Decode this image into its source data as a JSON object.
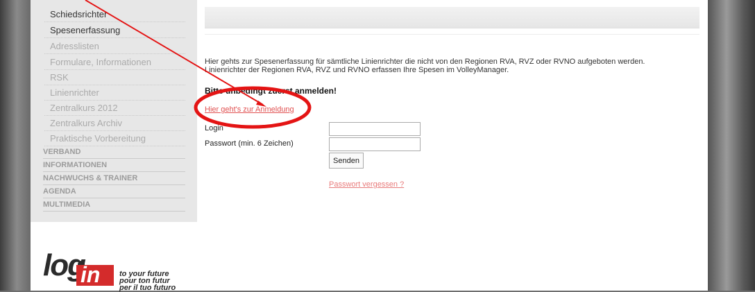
{
  "sidebar": {
    "sub_items": [
      {
        "label": "Schiedsrichter"
      },
      {
        "label": "Spesenerfassung"
      },
      {
        "label": "Adresslisten"
      },
      {
        "label": "Formulare, Informationen"
      },
      {
        "label": "RSK"
      },
      {
        "label": "Linienrichter"
      },
      {
        "label": "Zentralkurs 2012"
      },
      {
        "label": "Zentralkurs Archiv"
      },
      {
        "label": "Praktische Vorbereitung"
      }
    ],
    "categories": [
      {
        "label": "VERBAND"
      },
      {
        "label": "INFORMATIONEN"
      },
      {
        "label": "NACHWUCHS & TRAINER"
      },
      {
        "label": "AGENDA"
      },
      {
        "label": "MULTIMEDIA"
      }
    ]
  },
  "logo": {
    "text": "log-in",
    "tagline_1": "to your future",
    "tagline_2": "pour ton futur",
    "tagline_3": "per il tuo futuro"
  },
  "content": {
    "intro_line_1": "Hier gehts zur Spesenerfassung für sämtliche Linienrichter die nicht von den Regionen RVA, RVZ oder RVNO aufgeboten werden.",
    "intro_line_2": "Linienrichter der Regionen RVA, RVZ und RVNO erfassen Ihre Spesen im VolleyManager.",
    "warning": "Bitte unbedingt zuerst anmelden!",
    "register_link": "Hier geht's zur Anmeldung",
    "form": {
      "login_label": "Login",
      "login_value": "",
      "password_label": "Passwort (min. 6 Zeichen)",
      "password_value": "",
      "submit_label": "Senden",
      "forgot_link": "Passwort vergessen ?"
    }
  },
  "colors": {
    "annotation_red": "#e41414",
    "link_red": "#e05050"
  }
}
